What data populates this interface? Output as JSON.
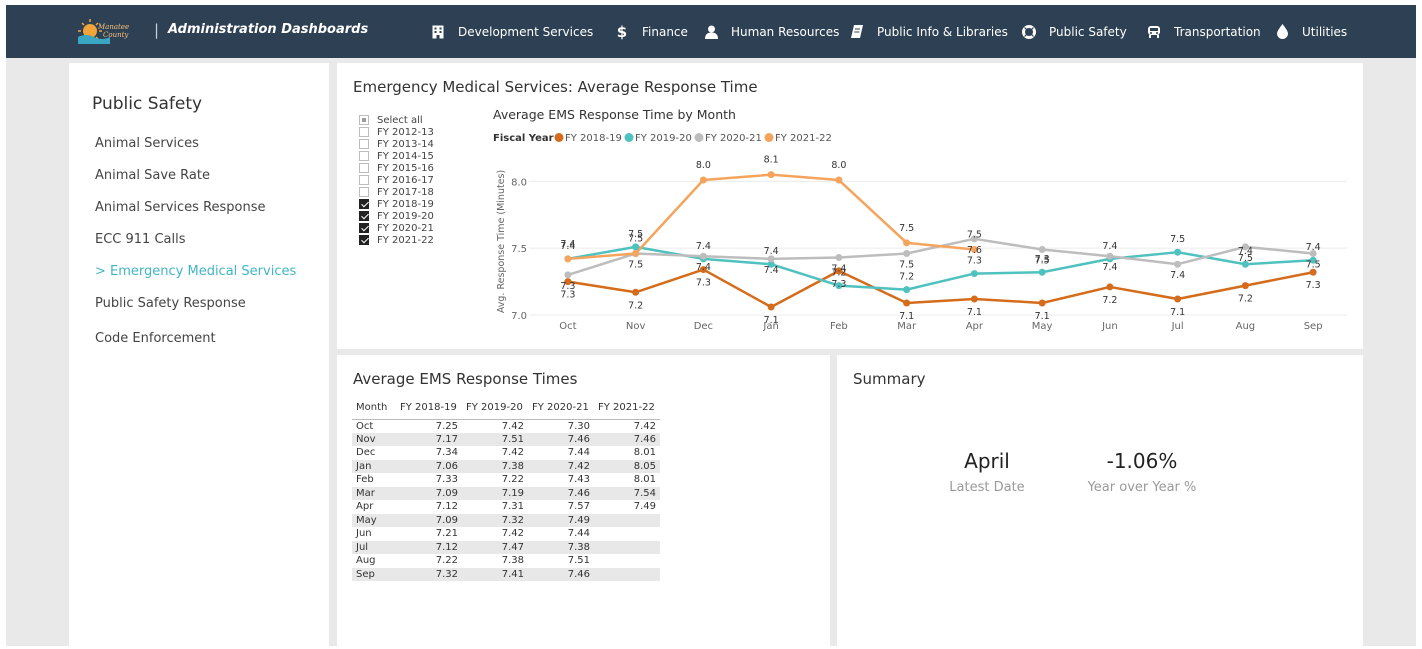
{
  "header": {
    "logo_text": "Manatee County",
    "title": "Administration Dashboards",
    "separator": "|",
    "nav": [
      {
        "label": "Development Services",
        "icon": "building-icon"
      },
      {
        "label": "Finance",
        "icon": "dollar-icon"
      },
      {
        "label": "Human Resources",
        "icon": "person-icon"
      },
      {
        "label": "Public Info & Libraries",
        "icon": "book-icon"
      },
      {
        "label": "Public Safety",
        "icon": "life-ring-icon"
      },
      {
        "label": "Transportation",
        "icon": "car-icon"
      },
      {
        "label": "Utilities",
        "icon": "water-drop-icon"
      }
    ]
  },
  "sidebar": {
    "title": "Public Safety",
    "items": [
      {
        "label": "Animal Services",
        "active": false
      },
      {
        "label": "Animal Save Rate",
        "active": false
      },
      {
        "label": "Animal Services Response",
        "active": false
      },
      {
        "label": "ECC 911 Calls",
        "active": false
      },
      {
        "label": "> Emergency Medical Services",
        "active": true
      },
      {
        "label": "Public Safety Response",
        "active": false
      },
      {
        "label": "Code Enforcement",
        "active": false
      }
    ],
    "active_color": "#41b6c4"
  },
  "chart_panel": {
    "title": "Emergency Medical Services: Average Response Time",
    "slicer": [
      {
        "label": "Select all",
        "state": "partial"
      },
      {
        "label": "FY 2012-13",
        "state": "unchecked"
      },
      {
        "label": "FY 2013-14",
        "state": "unchecked"
      },
      {
        "label": "FY 2014-15",
        "state": "unchecked"
      },
      {
        "label": "FY 2015-16",
        "state": "unchecked"
      },
      {
        "label": "FY 2016-17",
        "state": "unchecked"
      },
      {
        "label": "FY 2017-18",
        "state": "unchecked"
      },
      {
        "label": "FY 2018-19",
        "state": "checked"
      },
      {
        "label": "FY 2019-20",
        "state": "checked"
      },
      {
        "label": "FY 2020-21",
        "state": "checked"
      },
      {
        "label": "FY 2021-22",
        "state": "checked"
      }
    ]
  },
  "chart_data": {
    "type": "line",
    "title": "Average EMS Response Time by Month",
    "legend_title": "Fiscal Year",
    "legend_position": "top-left",
    "xlabel": "",
    "ylabel": "Avg. Response Time (Minutes)",
    "categories": [
      "Oct",
      "Nov",
      "Dec",
      "Jan",
      "Feb",
      "Mar",
      "Apr",
      "May",
      "Jun",
      "Jul",
      "Aug",
      "Sep"
    ],
    "ylim": [
      7.0,
      8.1
    ],
    "yticks": [
      "7.0",
      "7.5",
      "8.0"
    ],
    "grid": true,
    "series": [
      {
        "name": "FY 2018-19",
        "color": "#d46c1b",
        "values": [
          7.25,
          7.17,
          7.34,
          7.06,
          7.33,
          7.09,
          7.12,
          7.09,
          7.21,
          7.12,
          7.22,
          7.32
        ],
        "labels": [
          "7.3",
          "7.2",
          "7.3",
          "7.1",
          "7.3",
          "7.1",
          "7.1",
          "7.1",
          "7.2",
          "7.1",
          "7.2",
          "7.3"
        ]
      },
      {
        "name": "FY 2019-20",
        "color": "#4fc1bf",
        "values": [
          7.42,
          7.51,
          7.42,
          7.38,
          7.22,
          7.19,
          7.31,
          7.32,
          7.42,
          7.47,
          7.38,
          7.41
        ],
        "labels": [
          "7.4",
          "7.5",
          "7.4",
          "7.4",
          "7.2",
          "7.2",
          "7.3",
          "7.3",
          "7.4",
          "7.5",
          "7.4",
          "7.4"
        ]
      },
      {
        "name": "FY 2020-21",
        "color": "#bdbdbd",
        "values": [
          7.3,
          7.46,
          7.44,
          7.42,
          7.43,
          7.46,
          7.57,
          7.49,
          7.44,
          7.38,
          7.51,
          7.46
        ],
        "labels": [
          "7.3",
          "7.5",
          "7.4",
          "7.4",
          "7.4",
          "7.5",
          "7.6",
          "7.5",
          "7.4",
          "7.4",
          "7.5",
          "7.5"
        ]
      },
      {
        "name": "FY 2021-22",
        "color": "#f4a45c",
        "values": [
          7.42,
          7.46,
          8.01,
          8.05,
          8.01,
          7.54,
          7.49
        ],
        "labels": [
          "7.4",
          "7.5",
          "8.0",
          "8.1",
          "8.0",
          "7.5",
          "7.5"
        ]
      }
    ]
  },
  "table_panel": {
    "title": "Average EMS Response Times",
    "columns": [
      "Month",
      "FY 2018-19",
      "FY 2019-20",
      "FY 2020-21",
      "FY 2021-22"
    ],
    "rows": [
      [
        "Oct",
        "7.25",
        "7.42",
        "7.30",
        "7.42"
      ],
      [
        "Nov",
        "7.17",
        "7.51",
        "7.46",
        "7.46"
      ],
      [
        "Dec",
        "7.34",
        "7.42",
        "7.44",
        "8.01"
      ],
      [
        "Jan",
        "7.06",
        "7.38",
        "7.42",
        "8.05"
      ],
      [
        "Feb",
        "7.33",
        "7.22",
        "7.43",
        "8.01"
      ],
      [
        "Mar",
        "7.09",
        "7.19",
        "7.46",
        "7.54"
      ],
      [
        "Apr",
        "7.12",
        "7.31",
        "7.57",
        "7.49"
      ],
      [
        "May",
        "7.09",
        "7.32",
        "7.49",
        ""
      ],
      [
        "Jun",
        "7.21",
        "7.42",
        "7.44",
        ""
      ],
      [
        "Jul",
        "7.12",
        "7.47",
        "7.38",
        ""
      ],
      [
        "Aug",
        "7.22",
        "7.38",
        "7.51",
        ""
      ],
      [
        "Sep",
        "7.32",
        "7.41",
        "7.46",
        ""
      ]
    ]
  },
  "summary_panel": {
    "title": "Summary",
    "latest_date_value": "April",
    "latest_date_label": "Latest Date",
    "yoy_value": "-1.06%",
    "yoy_label": "Year over Year %"
  },
  "colors": {
    "header_bg": "#2e4053",
    "page_bg": "#e9e9e9"
  }
}
